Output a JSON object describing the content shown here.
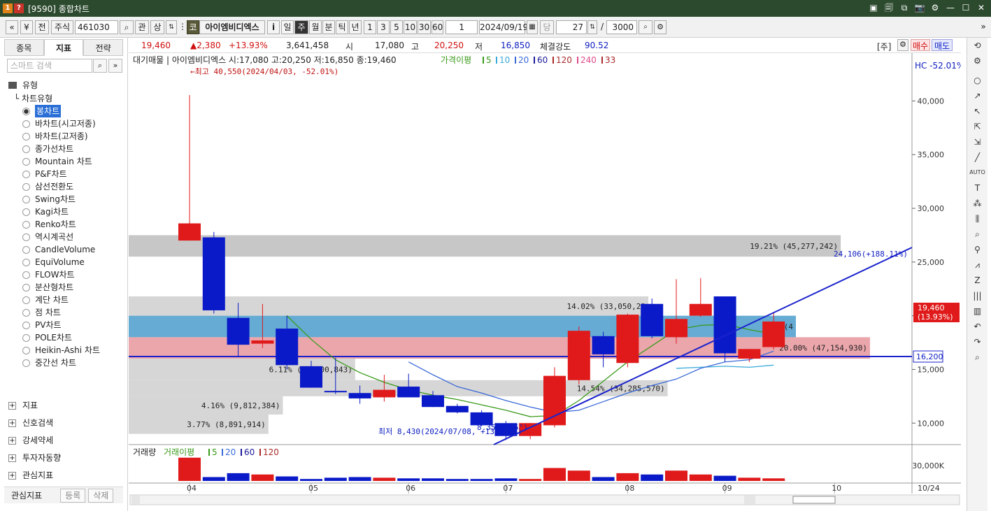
{
  "window": {
    "title": "[9590] 종합차트",
    "icons": [
      "1",
      "?"
    ],
    "buttons": [
      "▣",
      "🗐",
      "⧉",
      "📷",
      "⚙",
      "—",
      "☐",
      "✕"
    ]
  },
  "toolbar": {
    "nav_prev": "«",
    "nav_next": "»",
    "all": "전",
    "market": "주식",
    "code": "461030",
    "search_icon": "⌕",
    "gwan": "관",
    "sang": "상",
    "market_badge": "코",
    "stock_name": "아이엠비디엑스",
    "info": "i",
    "periods": [
      "일",
      "주",
      "월",
      "분",
      "틱",
      "년"
    ],
    "active_period": "주",
    "intervals": [
      "1",
      "3",
      "5",
      "10",
      "30",
      "60"
    ],
    "count": "1",
    "date": "2024/09/19",
    "dang": "당",
    "bars": "27",
    "slash": "/",
    "max_bars": "3000",
    "more": "»"
  },
  "left_panel": {
    "tabs": [
      "종목",
      "지표",
      "전략"
    ],
    "active_tab": "지표",
    "search_placeholder": "스마트 검색",
    "section_type": "유형",
    "chart_type_group": "차트유형",
    "chart_types": [
      "봉차트",
      "바차트(시고저종)",
      "바차트(고저종)",
      "종가선차트",
      "Mountain 차트",
      "P&F차트",
      "삼선전환도",
      "Swing차트",
      "Kagi차트",
      "Renko차트",
      "역시계곡선",
      "CandleVolume",
      "EquiVolume",
      "FLOW차트",
      "분산형차트",
      "계단 차트",
      "점 차트",
      "PV차트",
      "POLE차트",
      "Heikin-Ashi 차트",
      "중간선 차트"
    ],
    "selected_type": "봉차트",
    "folders": [
      "지표",
      "신호검색",
      "강세약세",
      "투자자동향",
      "관심지표"
    ],
    "favorites_label": "관심지표",
    "register": "등록",
    "delete": "삭제"
  },
  "quote": {
    "price": "19,460",
    "change": "▲2,380",
    "change_pct": "+13.93%",
    "volume": "3,641,458",
    "open_label": "시",
    "open": "17,080",
    "high_label": "고",
    "high": "20,250",
    "low_label": "저",
    "low": "16,850",
    "strength_label": "체결강도",
    "strength": "90.52",
    "unit": "[주]",
    "buy": "매수",
    "sell": "매도"
  },
  "chart_data": {
    "type": "candlestick",
    "header": "대기매물 | 아이엠비디엑스 시:17,080 고:20,250 저:16,850 종:19,460",
    "ma_legend": {
      "label": "가격이평",
      "items": [
        {
          "text": "5",
          "color": "#3a9a1a"
        },
        {
          "text": "10",
          "color": "#3aaad8"
        },
        {
          "text": "20",
          "color": "#3a6ad8"
        },
        {
          "text": "60",
          "color": "#1a1a9a"
        },
        {
          "text": "120",
          "color": "#aa2a2a"
        },
        {
          "text": "240",
          "color": "#e04a8a"
        },
        {
          "text": "33",
          "color": "#aa2a2a"
        }
      ]
    },
    "hc_label": "HC -52.01%",
    "ylim": [
      8000,
      42500
    ],
    "yticks": [
      "40,000",
      "35,000",
      "30,000",
      "25,000",
      "20,000",
      "15,000",
      "10,000"
    ],
    "ytick_values": [
      40000,
      35000,
      30000,
      25000,
      20000,
      15000,
      10000
    ],
    "x_labels": [
      "04",
      "05",
      "06",
      "07",
      "08",
      "09",
      "10"
    ],
    "x_label_index": [
      0,
      5,
      9,
      13,
      18,
      22,
      26.5
    ],
    "candles": [
      {
        "o": 27000,
        "h": 40550,
        "l": 27000,
        "c": 28600
      },
      {
        "o": 27300,
        "h": 27800,
        "l": 20200,
        "c": 20500
      },
      {
        "o": 19800,
        "h": 21200,
        "l": 16200,
        "c": 17300
      },
      {
        "o": 17400,
        "h": 21100,
        "l": 17000,
        "c": 17700
      },
      {
        "o": 18800,
        "h": 20000,
        "l": 15000,
        "c": 15400
      },
      {
        "o": 15300,
        "h": 15800,
        "l": 13300,
        "c": 13300
      },
      {
        "o": 13000,
        "h": 16100,
        "l": 12700,
        "c": 12900
      },
      {
        "o": 12800,
        "h": 13500,
        "l": 11800,
        "c": 12300
      },
      {
        "o": 12400,
        "h": 14500,
        "l": 12000,
        "c": 13100
      },
      {
        "o": 13400,
        "h": 14600,
        "l": 12500,
        "c": 12400
      },
      {
        "o": 12600,
        "h": 13000,
        "l": 11500,
        "c": 11500
      },
      {
        "o": 11600,
        "h": 11800,
        "l": 10900,
        "c": 11000
      },
      {
        "o": 11000,
        "h": 11200,
        "l": 9700,
        "c": 9800
      },
      {
        "o": 10000,
        "h": 10200,
        "l": 8430,
        "c": 8800
      },
      {
        "o": 8800,
        "h": 10000,
        "l": 8500,
        "c": 10000
      },
      {
        "o": 9800,
        "h": 15200,
        "l": 9600,
        "c": 14400
      },
      {
        "o": 14000,
        "h": 19000,
        "l": 13600,
        "c": 18600
      },
      {
        "o": 18100,
        "h": 18500,
        "l": 15200,
        "c": 16400
      },
      {
        "o": 15600,
        "h": 20200,
        "l": 15200,
        "c": 20100
      },
      {
        "o": 21100,
        "h": 21600,
        "l": 17900,
        "c": 18100
      },
      {
        "o": 18000,
        "h": 23400,
        "l": 17400,
        "c": 19700
      },
      {
        "o": 20000,
        "h": 23500,
        "l": 19900,
        "c": 21100
      },
      {
        "o": 21800,
        "h": 21800,
        "l": 15700,
        "c": 16500
      },
      {
        "o": 16000,
        "h": 16900,
        "l": 15700,
        "c": 16900
      },
      {
        "o": 17080,
        "h": 20250,
        "l": 16850,
        "c": 19460
      }
    ],
    "ma5": [
      null,
      null,
      null,
      null,
      20000,
      17800,
      15900,
      14700,
      13800,
      13100,
      12600,
      12200,
      11700,
      11200,
      10600,
      10700,
      12100,
      13900,
      15700,
      17200,
      18700,
      19100,
      19200,
      18700,
      18300
    ],
    "ma10": [
      null,
      null,
      null,
      null,
      null,
      null,
      null,
      null,
      null,
      15700,
      14500,
      13400,
      12800,
      12100,
      11500,
      11000,
      11200,
      12000,
      12800,
      13500,
      14100,
      15100,
      15700,
      15900,
      16700
    ],
    "ma20": [
      null,
      null,
      null,
      null,
      null,
      null,
      null,
      null,
      null,
      null,
      null,
      null,
      null,
      null,
      null,
      null,
      null,
      null,
      null,
      null,
      15100,
      15200,
      15300,
      15200,
      15400
    ],
    "volume_profile": [
      {
        "label": "19.21% (45,277,242)",
        "low": 25500,
        "high": 27500,
        "pct": 19.21,
        "color": "#bdbdbd"
      },
      {
        "label": "14.02% (33,050,21",
        "low": 20000,
        "high": 21800,
        "pct": 14.02,
        "color": "#cfcfcf"
      },
      {
        "label": "18% (4",
        "low": 18000,
        "high": 20000,
        "pct": 18.0,
        "color": "#4a9ccc"
      },
      {
        "label": "20.00% (47,154,930)",
        "low": 16000,
        "high": 18000,
        "pct": 20.0,
        "color": "#e8969e"
      },
      {
        "label": "6.11% (14,400,843)",
        "low": 14000,
        "high": 16000,
        "pct": 6.11,
        "color": "#cfcfcf"
      },
      {
        "label": "14.54% (34,285,570)",
        "low": 12500,
        "high": 14000,
        "pct": 14.54,
        "color": "#cfcfcf"
      },
      {
        "label": "4.16% (9,812,384)",
        "low": 10800,
        "high": 12500,
        "pct": 4.16,
        "color": "#cfcfcf"
      },
      {
        "label": "3.77% (8,891,914)",
        "low": 9000,
        "high": 10800,
        "pct": 3.77,
        "color": "#cfcfcf"
      }
    ],
    "hline_value": 16200,
    "hline_label": "16,200",
    "current_label": "19,460",
    "current_pct": "(13.93%)",
    "max_annotation": "←최고 40,550(2024/04/03, -52.01%)",
    "min_annotation": "최저 8,430(2024/07/08, +130.84%)",
    "trend_annotation": "24,106(+188.11%)",
    "trend_extra": "8.35% (35°)",
    "volume_panel": {
      "header": "거래량",
      "ma_label": "거래이평",
      "ma_items": [
        {
          "text": "5",
          "color": "#3a9a1a"
        },
        {
          "text": "20",
          "color": "#3a6ad8"
        },
        {
          "text": "60",
          "color": "#1a1a9a"
        },
        {
          "text": "120",
          "color": "#aa2a2a"
        }
      ],
      "ytick": "30,000K",
      "ymax": 40000,
      "volumes": [
        36000,
        6000,
        12000,
        10000,
        7000,
        3000,
        5000,
        6000,
        5000,
        4000,
        4000,
        3000,
        3000,
        4000,
        3000,
        20000,
        16000,
        6000,
        12000,
        10000,
        16000,
        10000,
        8000,
        5000,
        4000
      ]
    },
    "date_right": "10/24"
  },
  "colors": {
    "up": "#e01a1a",
    "down": "#0a1ac8",
    "trend": "#1a22cc",
    "titlebar": "#2c4a2e"
  }
}
